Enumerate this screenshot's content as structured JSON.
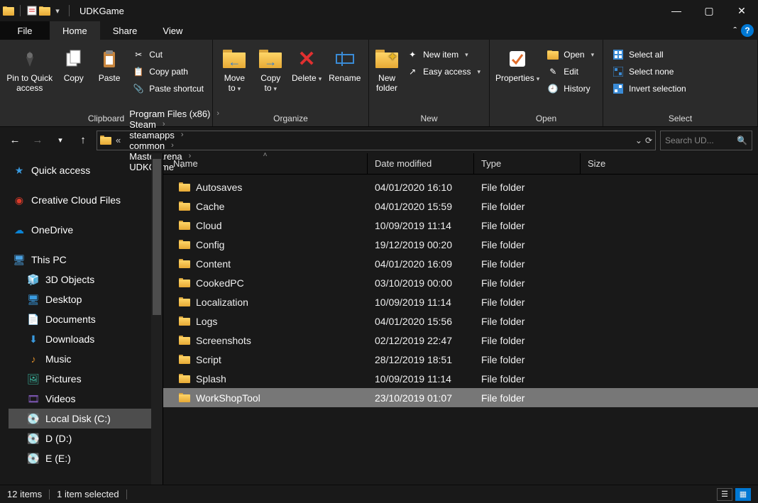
{
  "title": "UDKGame",
  "tabs": {
    "file": "File",
    "home": "Home",
    "share": "Share",
    "view": "View"
  },
  "ribbon": {
    "clipboard": {
      "label": "Clipboard",
      "pin": "Pin to Quick\naccess",
      "copy": "Copy",
      "paste": "Paste",
      "cut": "Cut",
      "copy_path": "Copy path",
      "paste_shortcut": "Paste shortcut"
    },
    "organize": {
      "label": "Organize",
      "move_to": "Move\nto",
      "copy_to": "Copy\nto",
      "delete": "Delete",
      "rename": "Rename"
    },
    "new": {
      "label": "New",
      "new_folder": "New\nfolder",
      "new_item": "New item",
      "easy_access": "Easy access"
    },
    "open": {
      "label": "Open",
      "properties": "Properties",
      "open": "Open",
      "edit": "Edit",
      "history": "History"
    },
    "select": {
      "label": "Select",
      "select_all": "Select all",
      "select_none": "Select none",
      "invert": "Invert selection"
    }
  },
  "breadcrumb": [
    "Program Files (x86)",
    "Steam",
    "steamapps",
    "common",
    "MasterArena",
    "UDKGame"
  ],
  "search_placeholder": "Search UD...",
  "columns": {
    "name": "Name",
    "date": "Date modified",
    "type": "Type",
    "size": "Size"
  },
  "sidebar": {
    "quick_access": "Quick access",
    "creative_cloud": "Creative Cloud Files",
    "onedrive": "OneDrive",
    "this_pc": "This PC",
    "items": [
      "3D Objects",
      "Desktop",
      "Documents",
      "Downloads",
      "Music",
      "Pictures",
      "Videos",
      "Local Disk (C:)",
      "D (D:)",
      "E (E:)"
    ]
  },
  "files": [
    {
      "name": "Autosaves",
      "date": "04/01/2020 16:10",
      "type": "File folder"
    },
    {
      "name": "Cache",
      "date": "04/01/2020 15:59",
      "type": "File folder"
    },
    {
      "name": "Cloud",
      "date": "10/09/2019 11:14",
      "type": "File folder"
    },
    {
      "name": "Config",
      "date": "19/12/2019 00:20",
      "type": "File folder"
    },
    {
      "name": "Content",
      "date": "04/01/2020 16:09",
      "type": "File folder"
    },
    {
      "name": "CookedPC",
      "date": "03/10/2019 00:00",
      "type": "File folder"
    },
    {
      "name": "Localization",
      "date": "10/09/2019 11:14",
      "type": "File folder"
    },
    {
      "name": "Logs",
      "date": "04/01/2020 15:56",
      "type": "File folder"
    },
    {
      "name": "Screenshots",
      "date": "02/12/2019 22:47",
      "type": "File folder"
    },
    {
      "name": "Script",
      "date": "28/12/2019 18:51",
      "type": "File folder"
    },
    {
      "name": "Splash",
      "date": "10/09/2019 11:14",
      "type": "File folder"
    },
    {
      "name": "WorkShopTool",
      "date": "23/10/2019 01:07",
      "type": "File folder",
      "selected": true
    }
  ],
  "status": {
    "count": "12 items",
    "selected": "1 item selected"
  }
}
